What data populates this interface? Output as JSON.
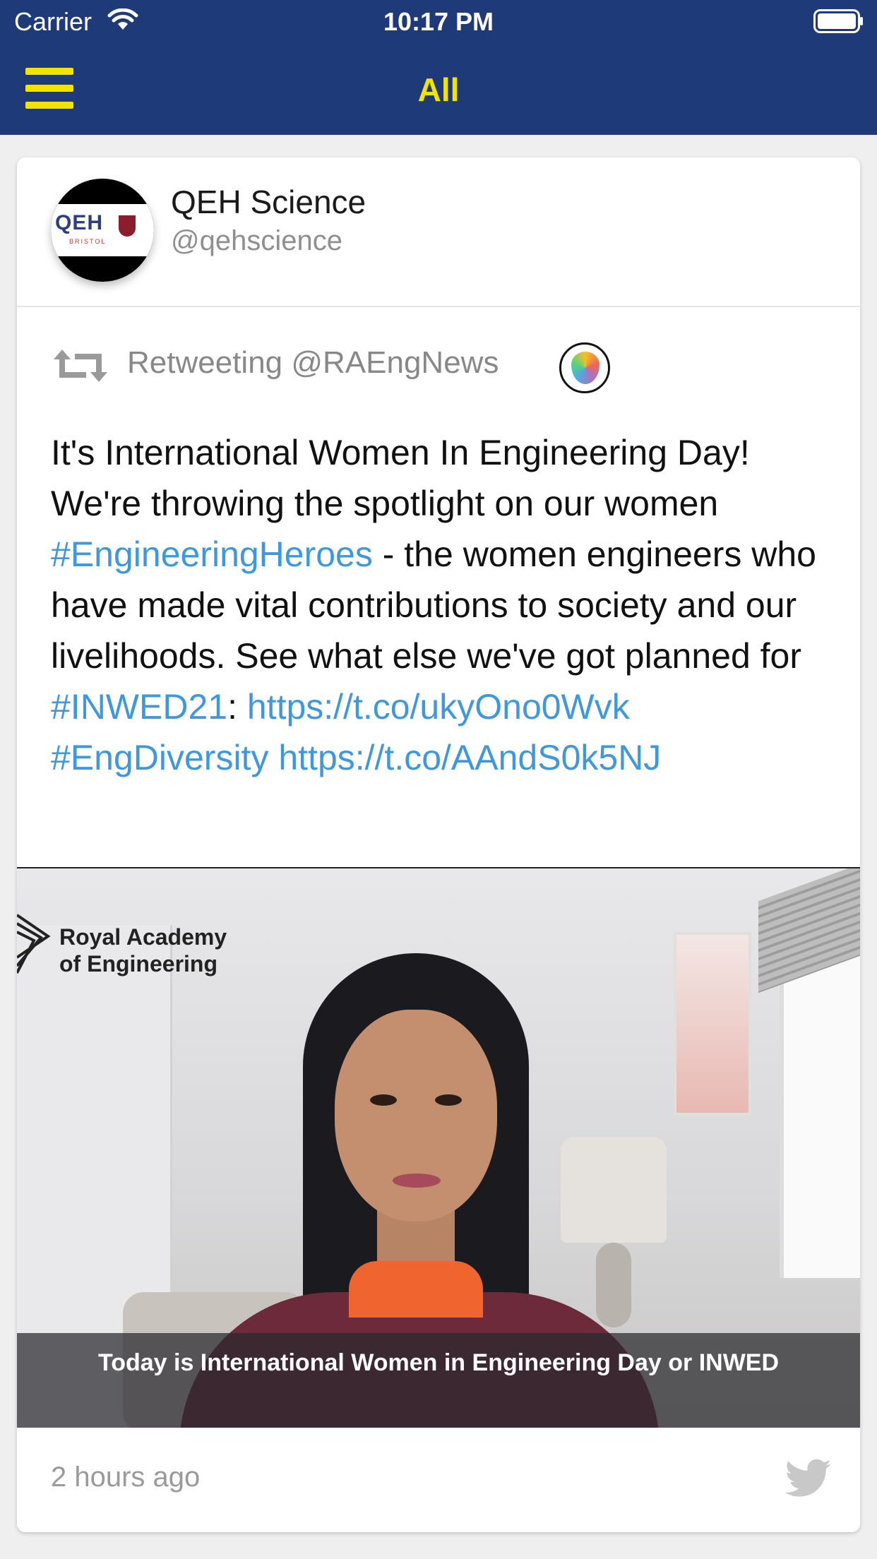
{
  "status_bar": {
    "carrier": "Carrier",
    "time": "10:17 PM"
  },
  "nav": {
    "title": "All",
    "menu_icon": "hamburger-menu-icon"
  },
  "colors": {
    "header_bg": "#1f3a78",
    "accent_yellow": "#f4e200",
    "link_blue": "#3f97dc",
    "muted_gray": "#8f8f8f"
  },
  "tweet": {
    "author_name": "QEH Science",
    "author_handle": "@qehscience",
    "avatar_logo_text": "QEH",
    "avatar_logo_sub": "BRISTOL",
    "retweet_label": "Retweeting @RAEngNews",
    "text_segments": [
      {
        "text": "It's International Women In Engineering Day! We're throwing the spotlight on our women ",
        "link": false
      },
      {
        "text": "#EngineeringHeroes",
        "link": true
      },
      {
        "text": " - the women engineers who have made vital contributions to society and our livelihoods. See what else we've got planned for ",
        "link": false
      },
      {
        "text": "#INWED21",
        "link": true
      },
      {
        "text": ": ",
        "link": false
      },
      {
        "text": "https://t.co/ukyOno0Wvk",
        "link": true
      },
      {
        "text": " ",
        "link": false
      },
      {
        "text": "#EngDiversity",
        "link": true
      },
      {
        "text": " ",
        "link": false
      },
      {
        "text": "https://t.co/AAndS0k5NJ",
        "link": true
      }
    ],
    "media": {
      "overlay_logo_text": "Royal Academy\nof Engineering",
      "caption": "Today is International Women in Engineering Day or INWED"
    },
    "timestamp": "2 hours ago",
    "source_icon": "twitter-bird-icon"
  }
}
